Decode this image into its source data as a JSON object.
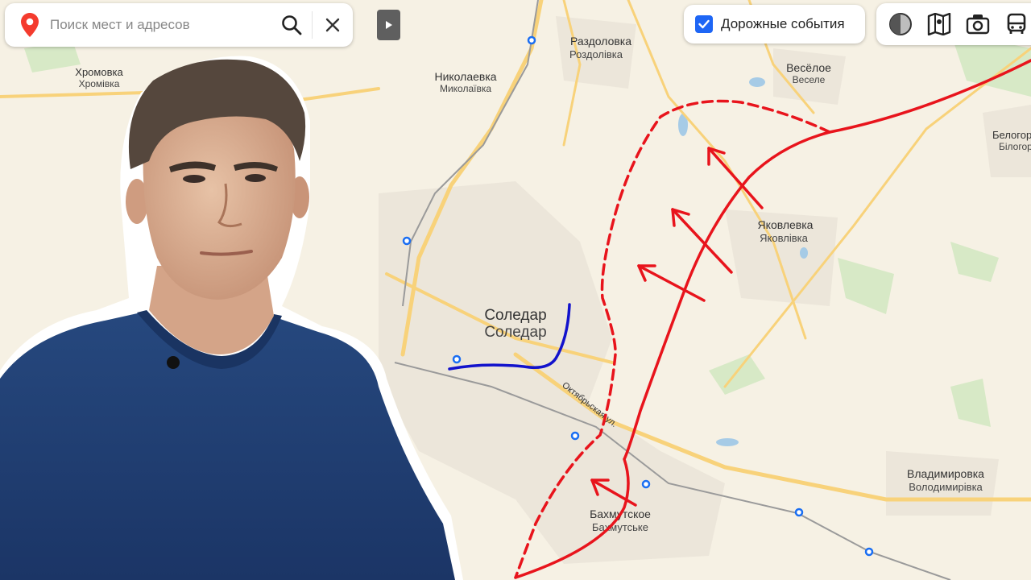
{
  "search": {
    "placeholder": "Поиск мест и адресов",
    "icon_pin": "map-pin-icon",
    "icon_search": "search-icon",
    "icon_close": "close-icon"
  },
  "collapse_icon": "play-triangle-icon",
  "traffic": {
    "label": "Дорожные события",
    "checked": true,
    "accent": "#1e66f5"
  },
  "layers": [
    "dimmer-icon",
    "map-scheme-icon",
    "panorama-icon",
    "transport-icon"
  ],
  "places": {
    "khromovka": {
      "ru": "Хромовка",
      "ua": "Хромівка"
    },
    "razdolovka": {
      "ru": "Раздоловка",
      "ua": "Роздолівка"
    },
    "nikolaevka": {
      "ru": "Николаевка",
      "ua": "Миколаївка"
    },
    "veseloe": {
      "ru": "Весёлое",
      "ua": "Веселе"
    },
    "belogor": {
      "ru": "Белогор",
      "ua": "Білогор"
    },
    "yakovlevka": {
      "ru": "Яковлевка",
      "ua": "Яковлівка"
    },
    "soledar": {
      "ru": "Соледар",
      "ua": "Соледар"
    },
    "vladimirovka": {
      "ru": "Владимировка",
      "ua": "Володимирівка"
    },
    "bakhmutskoe": {
      "ru": "Бахмутское",
      "ua": "Бахмутське"
    }
  },
  "street": "Октябрьская ул.",
  "colors": {
    "front_line": "#e8141c",
    "blue_line": "#1212cc",
    "roads": "#f8d27a",
    "rail": "#9a9a9a",
    "station": "#1a6ef2"
  },
  "overlay": {
    "subject": "man-in-blue-sweater",
    "icon": "portrait-photo"
  }
}
